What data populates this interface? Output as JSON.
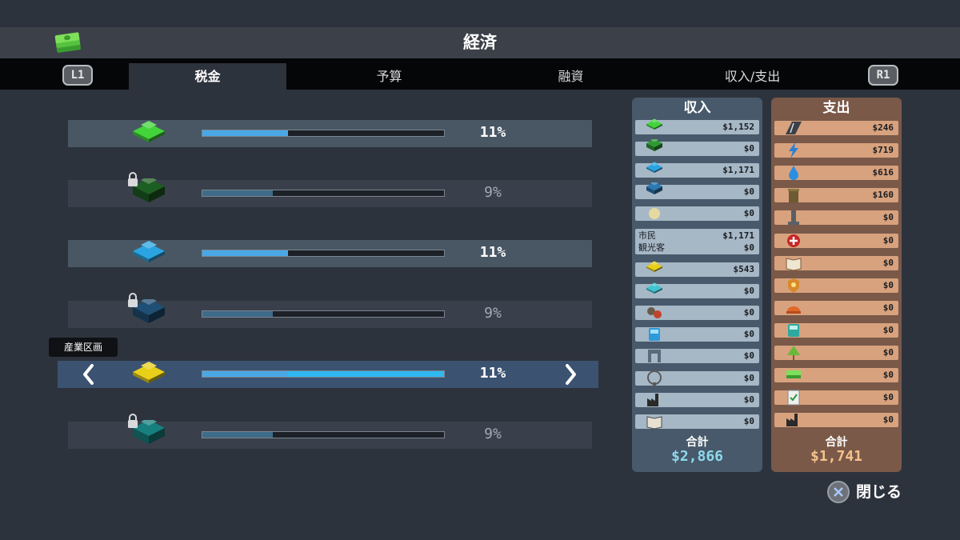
{
  "header": {
    "title": "経済",
    "icon": "money-stack-icon"
  },
  "tabs": {
    "left_shoulder": "L1",
    "right_shoulder": "R1",
    "items": [
      "税金",
      "予算",
      "融資",
      "収入/支出"
    ],
    "active": "税金"
  },
  "tax_rows": [
    {
      "icon": "residential-low-icon",
      "color": "#43d33a",
      "percent": "11%",
      "level": 0.11,
      "locked": false
    },
    {
      "icon": "residential-high-icon",
      "color": "#1d5e22",
      "percent": "9%",
      "level": 0.09,
      "locked": true
    },
    {
      "icon": "commercial-low-icon",
      "color": "#2aa4e0",
      "percent": "11%",
      "level": 0.11,
      "locked": false
    },
    {
      "icon": "commercial-high-icon",
      "color": "#1f4f74",
      "percent": "9%",
      "level": 0.09,
      "locked": true
    },
    {
      "icon": "industrial-icon",
      "color": "#e8cf1a",
      "percent": "11%",
      "level": 0.11,
      "locked": false,
      "selected": true,
      "tooltip": "産業区画"
    },
    {
      "icon": "office-icon",
      "color": "#17807e",
      "percent": "9%",
      "level": 0.09,
      "locked": true
    }
  ],
  "income": {
    "title": "収入",
    "items": [
      {
        "icon": "residential-low-icon",
        "value": "$1,152"
      },
      {
        "icon": "residential-high-icon",
        "value": "$0"
      },
      {
        "icon": "commercial-low-icon",
        "value": "$1,171"
      },
      {
        "icon": "commercial-high-icon",
        "value": "$0"
      },
      {
        "icon": "specialized-commercial-icon",
        "value": "$0"
      }
    ],
    "citizen_label": "市民",
    "citizen_value": "$1,171",
    "tourist_label": "観光客",
    "tourist_value": "$0",
    "items2": [
      {
        "icon": "industrial-icon",
        "value": "$543"
      },
      {
        "icon": "office-icon",
        "value": "$0"
      },
      {
        "icon": "specialized-industry-icon",
        "value": "$0"
      },
      {
        "icon": "public-transport-icon",
        "value": "$0"
      },
      {
        "icon": "transport-building-icon",
        "value": "$0"
      },
      {
        "icon": "park-ferris-wheel-icon",
        "value": "$0"
      },
      {
        "icon": "industry-building-icon",
        "value": "$0"
      },
      {
        "icon": "book-icon",
        "value": "$0"
      }
    ],
    "total_label": "合計",
    "total_value": "$2,866"
  },
  "expense": {
    "title": "支出",
    "items": [
      {
        "icon": "road-icon",
        "value": "$246"
      },
      {
        "icon": "electricity-icon",
        "value": "$719"
      },
      {
        "icon": "water-drop-icon",
        "value": "$616"
      },
      {
        "icon": "garbage-bin-icon",
        "value": "$160"
      },
      {
        "icon": "monument-icon",
        "value": "$0"
      },
      {
        "icon": "healthcare-icon",
        "value": "$0"
      },
      {
        "icon": "education-book-icon",
        "value": "$0"
      },
      {
        "icon": "police-badge-icon",
        "value": "$0"
      },
      {
        "icon": "fire-helmet-icon",
        "value": "$0"
      },
      {
        "icon": "bus-icon",
        "value": "$0"
      },
      {
        "icon": "tree-park-icon",
        "value": "$0"
      },
      {
        "icon": "money-stack-icon",
        "value": "$0"
      },
      {
        "icon": "policy-document-icon",
        "value": "$0"
      },
      {
        "icon": "factory-icon",
        "value": "$0"
      }
    ],
    "total_label": "合計",
    "total_value": "$1,741"
  },
  "footer": {
    "close_label": "閉じる",
    "close_icon": "cross-button-icon"
  },
  "colors": {
    "income_panel": "#47596a",
    "expense_panel": "#7a5949",
    "bar": "#49a8e4"
  }
}
